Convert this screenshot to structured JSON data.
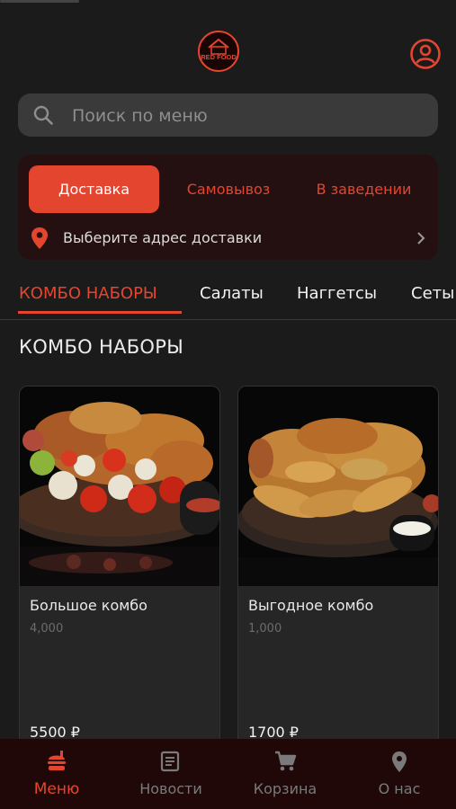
{
  "app": {
    "logo_text": "RED FOOD",
    "accent_color": "#e4452f"
  },
  "search": {
    "placeholder": "Поиск по меню",
    "icon": "search-icon"
  },
  "delivery": {
    "tabs": [
      {
        "label": "Доставка",
        "active": true
      },
      {
        "label": "Самовывоз",
        "active": false
      },
      {
        "label": "В заведении",
        "active": false
      }
    ],
    "address_prompt": "Выберите адрес доставки"
  },
  "categories": [
    {
      "label": "КОМБО НАБОРЫ",
      "active": true
    },
    {
      "label": "Салаты",
      "active": false
    },
    {
      "label": "Наггетсы",
      "active": false
    },
    {
      "label": "Сеты",
      "active": false
    }
  ],
  "section": {
    "title": "КОМБО НАБОРЫ"
  },
  "products": [
    {
      "name": "Большое комбо",
      "weight": "4,000",
      "price": "5500 ₽"
    },
    {
      "name": "Выгодное комбо",
      "weight": "1,000",
      "price": "1700 ₽"
    }
  ],
  "bottom_nav": [
    {
      "label": "Меню",
      "icon": "burger-icon",
      "active": true
    },
    {
      "label": "Новости",
      "icon": "news-icon",
      "active": false
    },
    {
      "label": "Корзина",
      "icon": "cart-icon",
      "active": false
    },
    {
      "label": "О нас",
      "icon": "location-icon",
      "active": false
    }
  ]
}
